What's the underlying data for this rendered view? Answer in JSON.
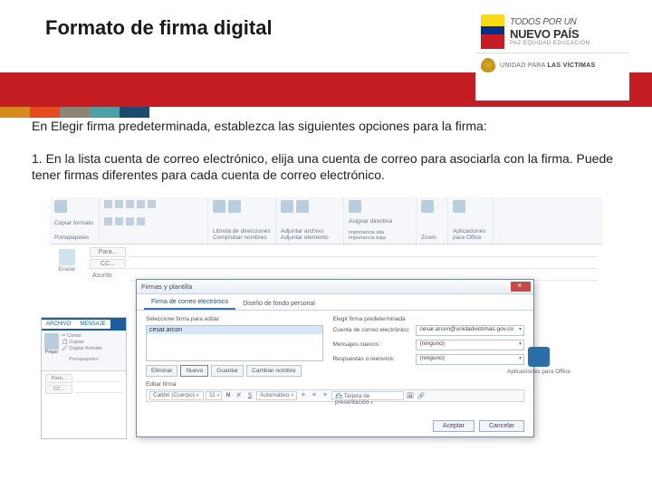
{
  "header": {
    "title": "Formato de firma digital"
  },
  "logo": {
    "line1": "TODOS POR UN",
    "line2": "NUEVO PAÍS",
    "line3": "PAZ  EQUIDAD  EDUCACIÓN",
    "sub": "UNIDAD PARA LAS VÍCTIMAS"
  },
  "intro": "En Elegir firma predeterminada, establezca las siguientes opciones para la firma:",
  "step1": "1. En la lista cuenta de correo electrónico, elija una cuenta de correo para asociarla con la firma. Puede tener firmas diferentes para cada cuenta de correo electrónico.",
  "ribbon": {
    "clipboard": "Portapapeles",
    "copy_format": "Copiar formato",
    "address_book": "Libreta de direcciones",
    "check_names": "Comprobar nombres",
    "attach_file": "Adjuntar archivo",
    "attach_item": "Adjuntar elemento",
    "assign_policy": "Asignar directiva",
    "high_importance": "Importancia alta",
    "low_importance": "Importancia baja",
    "zoom": "Zoom",
    "office_apps": "Aplicaciones para Office"
  },
  "fields": {
    "to": "Para...",
    "cc": "CC...",
    "subject": "Asunto",
    "send": "Enviar"
  },
  "dialog": {
    "title": "Firmas y plantilla",
    "tab_email": "Firma de correo electrónico",
    "tab_personal": "Diseño de fondo personal",
    "select_label": "Seleccione firma para editar",
    "sig_name": "cesar.arcon",
    "btn_delete": "Eliminar",
    "btn_new": "Nuevo",
    "btn_save": "Guardar",
    "btn_rename": "Cambiar nombre",
    "default_title": "Elegir firma predeterminada",
    "account_label": "Cuenta de correo electrónico:",
    "account_value": "cesar.arcon@unidadvictimas.gov.co",
    "new_msg_label": "Mensajes nuevos:",
    "new_msg_value": "(ninguno)",
    "reply_label": "Respuestas o reenvíos:",
    "reply_value": "(ninguno)",
    "edit_label": "Editar firma",
    "font": "Calibri (Cuerpo)",
    "font_size": "11",
    "auto": "Automático",
    "business_card": "Tarjeta de presentación",
    "ok": "Aceptar",
    "cancel": "Cancelar"
  },
  "second_window": {
    "file_tab": "ARCHIVO",
    "msg_tab": "MENSAJE",
    "paste": "Pegar",
    "cut": "Cortar",
    "copy": "Copiar",
    "copy_fmt": "Copiar formato",
    "clipboard": "Portapapeles",
    "to": "Para...",
    "cc": "CC..."
  }
}
